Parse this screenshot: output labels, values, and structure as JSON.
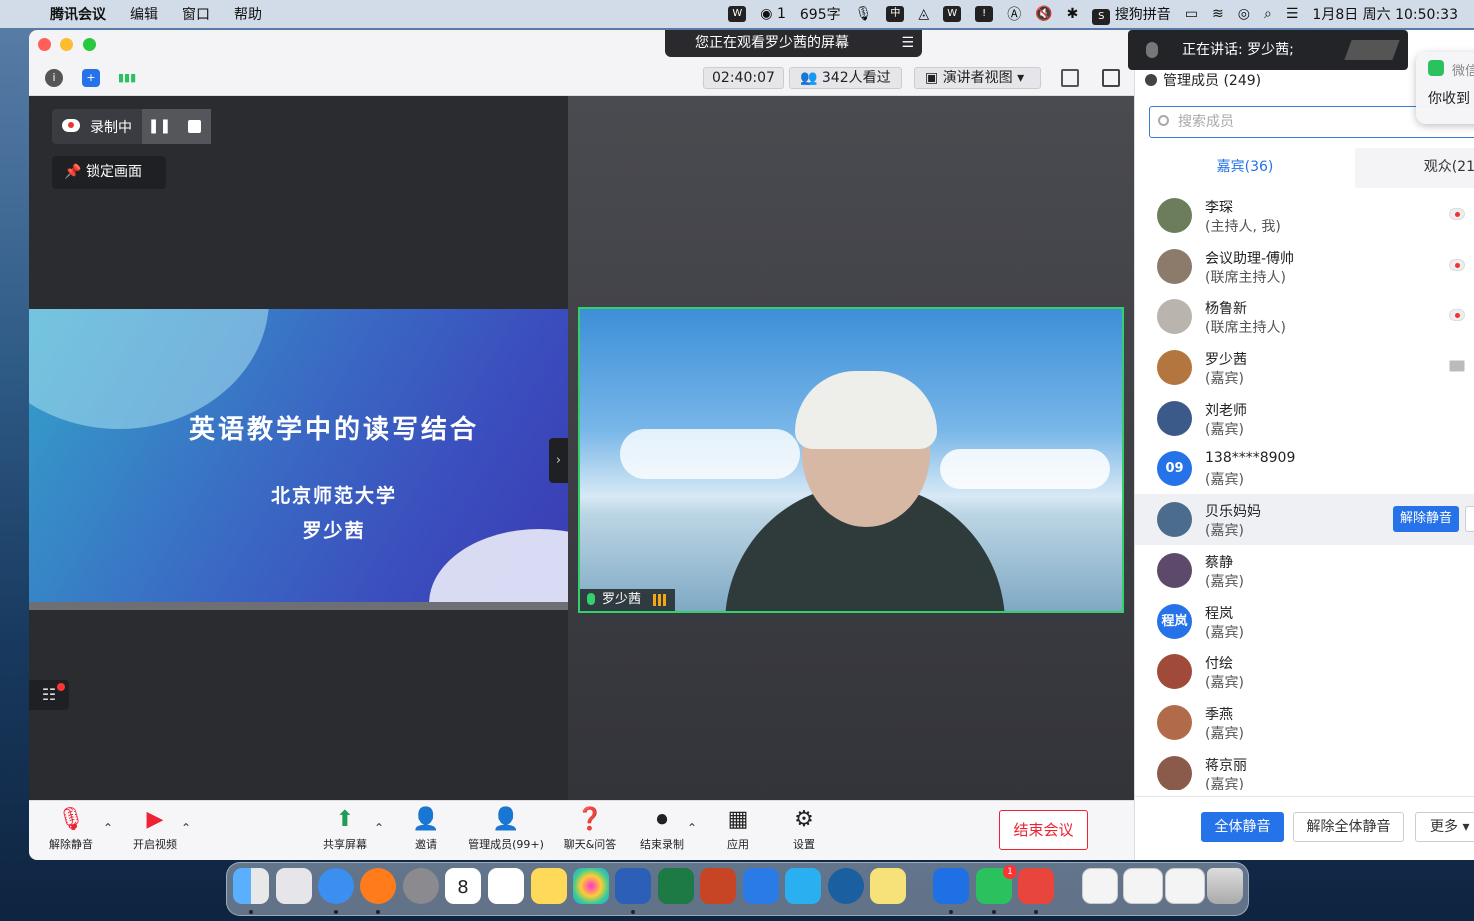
{
  "menubar": {
    "app_name": "腾讯会议",
    "menus": [
      "编辑",
      "窗口",
      "帮助"
    ],
    "wechat_count": "1",
    "word_count": "695字",
    "ime_cn": "中",
    "ime_name": "搜狗拼音",
    "datetime": "1月8日 周六  10:50:33"
  },
  "window": {
    "watching_banner": "您正在观看罗少茜的屏幕",
    "timer": "02:40:07",
    "viewers": "342人看过",
    "view_mode": "演讲者视图 ▾"
  },
  "stage": {
    "recording_label": "录制中",
    "pause_symbol": "❚❚",
    "lock_label": "锁定画面",
    "slide_title": "英语教学中的读写结合",
    "slide_sub1": "北京师范大学",
    "slide_sub2": "罗少茜",
    "presenter_name": "罗少茜"
  },
  "bottombar": {
    "unmute": "解除静音",
    "start_video": "开启视频",
    "share_screen": "共享屏幕",
    "invite": "邀请",
    "manage_members": "管理成员(99+)",
    "chat_qa": "聊天&问答",
    "end_recording": "结束录制",
    "apps": "应用",
    "settings": "设置",
    "end_meeting": "结束会议"
  },
  "panel": {
    "speaking_toast": "正在讲话: 罗少茜;",
    "header": "管理成员 (249)",
    "search_placeholder": "搜索成员",
    "tab_guests": "嘉宾(36)",
    "tab_audience": "观众(21",
    "members": [
      {
        "name": "李琛",
        "role": "(主持人, 我)",
        "avatar_color": "#6b7d5a",
        "status": "rec"
      },
      {
        "name": "会议助理-傅帅",
        "role": "(联席主持人)",
        "avatar_color": "#8c7a6b",
        "status": "rec"
      },
      {
        "name": "杨鲁新",
        "role": "(联席主持人)",
        "avatar_color": "#b9b4ad",
        "status": "rec"
      },
      {
        "name": "罗少茜",
        "role": "(嘉宾)",
        "avatar_color": "#b4763f",
        "status": "share"
      },
      {
        "name": "刘老师",
        "role": "(嘉宾)",
        "avatar_color": "#3b5a8a",
        "status": ""
      },
      {
        "name": "138****8909",
        "role": "(嘉宾)",
        "avatar_color": "#2672e8",
        "avatar_text": "09",
        "status": ""
      },
      {
        "name": "贝乐妈妈",
        "role": "(嘉宾)",
        "avatar_color": "#4b6c8c",
        "status": "",
        "unmute": "解除静音"
      },
      {
        "name": "蔡静",
        "role": "(嘉宾)",
        "avatar_color": "#5d4a6b",
        "status": ""
      },
      {
        "name": "程岚",
        "role": "(嘉宾)",
        "avatar_color": "#2672e8",
        "avatar_text": "程岚",
        "status": ""
      },
      {
        "name": "付绘",
        "role": "(嘉宾)",
        "avatar_color": "#a04a3a",
        "status": ""
      },
      {
        "name": "季燕",
        "role": "(嘉宾)",
        "avatar_color": "#b26b4a",
        "status": ""
      },
      {
        "name": "蒋京丽",
        "role": "(嘉宾)",
        "avatar_color": "#8a5a4a",
        "status": ""
      }
    ],
    "mute_all": "全体静音",
    "unmute_all": "解除全体静音",
    "more": "更多 ▾"
  },
  "wechat_toast": {
    "app": "微信",
    "message": "你收到"
  },
  "dock": {
    "calendar_day": "8",
    "wechat_badge": "1"
  }
}
